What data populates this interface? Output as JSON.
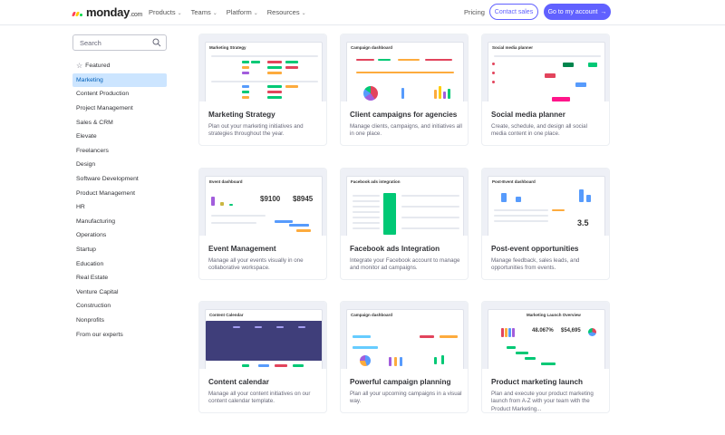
{
  "header": {
    "logo_text": "monday",
    "logo_suffix": ".com",
    "nav": [
      {
        "label": "Products"
      },
      {
        "label": "Teams"
      },
      {
        "label": "Platform"
      },
      {
        "label": "Resources"
      }
    ],
    "pricing": "Pricing",
    "contact_sales": "Contact sales",
    "go_to_account": "Go to my account",
    "brand_color": "#6161ff"
  },
  "sidebar": {
    "search_placeholder": "Search",
    "items": [
      {
        "label": "Featured",
        "icon": "star-icon"
      },
      {
        "label": "Marketing",
        "active": true
      },
      {
        "label": "Content Production"
      },
      {
        "label": "Project Management"
      },
      {
        "label": "Sales & CRM"
      },
      {
        "label": "Elevate"
      },
      {
        "label": "Freelancers"
      },
      {
        "label": "Design"
      },
      {
        "label": "Software Development"
      },
      {
        "label": "Product Management"
      },
      {
        "label": "HR"
      },
      {
        "label": "Manufacturing"
      },
      {
        "label": "Operations"
      },
      {
        "label": "Startup"
      },
      {
        "label": "Education"
      },
      {
        "label": "Real Estate"
      },
      {
        "label": "Venture Capital"
      },
      {
        "label": "Construction"
      },
      {
        "label": "Nonprofits"
      },
      {
        "label": "From our experts"
      }
    ]
  },
  "templates": [
    {
      "title": "Marketing Strategy",
      "description": "Plan out your marketing initiatives and strategies throughout the year.",
      "preview_title": "Marketing Strategy"
    },
    {
      "title": "Client campaigns for agencies",
      "description": "Manage clients, campaigns, and initiatives all in one place.",
      "preview_title": "Campaign dashboard"
    },
    {
      "title": "Social media planner",
      "description": "Create, schedule, and design all social media content in one place.",
      "preview_title": "Social media planner"
    },
    {
      "title": "Event Management",
      "description": "Manage all your events visually in one collaborative workspace.",
      "preview_title": "Event dashboard",
      "preview_values": [
        "$9100",
        "$8945"
      ]
    },
    {
      "title": "Facebook ads Integration",
      "description": "Integrate your Facebook account to manage and monitor ad campaigns.",
      "preview_title": "Facebook ads integration"
    },
    {
      "title": "Post-event opportunities",
      "description": "Manage feedback, sales leads, and opportunities from events.",
      "preview_title": "Post-Event dashboard",
      "preview_values": [
        "3.5"
      ]
    },
    {
      "title": "Content calendar",
      "description": "Manage all your content initiatives on our content calendar template.",
      "preview_title": "Content Calendar"
    },
    {
      "title": "Powerful campaign planning",
      "description": "Plan all your upcoming campaigns in a visual way.",
      "preview_title": "Campaign dashboard"
    },
    {
      "title": "Product marketing launch",
      "description": "Plan and execute your product marketing launch from A-Z with your team with the Product Marketing...",
      "preview_title": "Marketing Launch Overview",
      "preview_values": [
        "48.067%",
        "$54,695"
      ]
    }
  ]
}
